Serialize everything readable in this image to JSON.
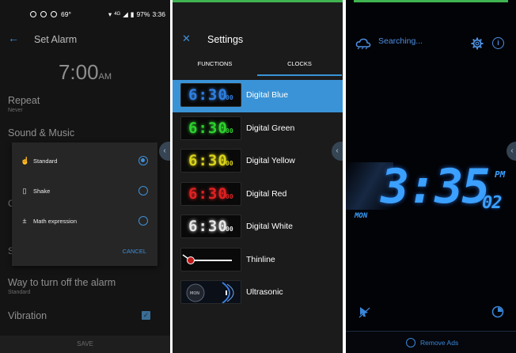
{
  "colors": {
    "accent": "#3f8fd8",
    "selected_row": "#3a93d6",
    "clock_blue": "#3ba0ff",
    "status_green": "#3fb450"
  },
  "status_bar": {
    "temperature": "69°",
    "signal": "4G",
    "battery": "97%",
    "time": "3:36"
  },
  "set_alarm": {
    "title": "Set Alarm",
    "time": "7:00",
    "ampm": "AM",
    "repeat_label": "Repeat",
    "repeat_value": "Never",
    "sound_label": "Sound & Music",
    "turn_off_label": "Way to turn off the alarm",
    "turn_off_value": "Standard",
    "vibration_label": "Vibration",
    "vibration_checked": true,
    "save_label": "SAVE",
    "dialog": {
      "options": [
        {
          "label": "Standard",
          "icon": "touch-icon",
          "selected": true
        },
        {
          "label": "Shake",
          "icon": "phone-shake-icon",
          "selected": false
        },
        {
          "label": "Math expression",
          "icon": "math-icon",
          "selected": false
        }
      ],
      "cancel_label": "CANCEL"
    }
  },
  "settings": {
    "title": "Settings",
    "tabs": [
      {
        "label": "FUNCTIONS",
        "active": false
      },
      {
        "label": "CLOCKS",
        "active": true
      }
    ],
    "clocks": [
      {
        "name": "Digital Blue",
        "color": "#2f7fe0",
        "selected": true,
        "preview": "6:30",
        "preview_seconds": "00"
      },
      {
        "name": "Digital Green",
        "color": "#2ed02e",
        "selected": false,
        "preview": "6:30",
        "preview_seconds": "00"
      },
      {
        "name": "Digital Yellow",
        "color": "#d8d21a",
        "selected": false,
        "preview": "6:30",
        "preview_seconds": "00"
      },
      {
        "name": "Digital Red",
        "color": "#e02222",
        "selected": false,
        "preview": "6:30",
        "preview_seconds": "00"
      },
      {
        "name": "Digital White",
        "color": "#e6e6e6",
        "selected": false,
        "preview": "6:30",
        "preview_seconds": "00"
      },
      {
        "name": "Thinline",
        "color": "#ffffff",
        "selected": false,
        "preview": "",
        "preview_seconds": ""
      },
      {
        "name": "Ultrasonic",
        "color": "#4a8ae0",
        "selected": false,
        "preview": "",
        "preview_seconds": ""
      }
    ]
  },
  "clock_screen": {
    "status": "Searching...",
    "time": "3:35",
    "ampm": "PM",
    "seconds": "02",
    "day": "MON",
    "remove_ads_label": "Remove Ads"
  }
}
